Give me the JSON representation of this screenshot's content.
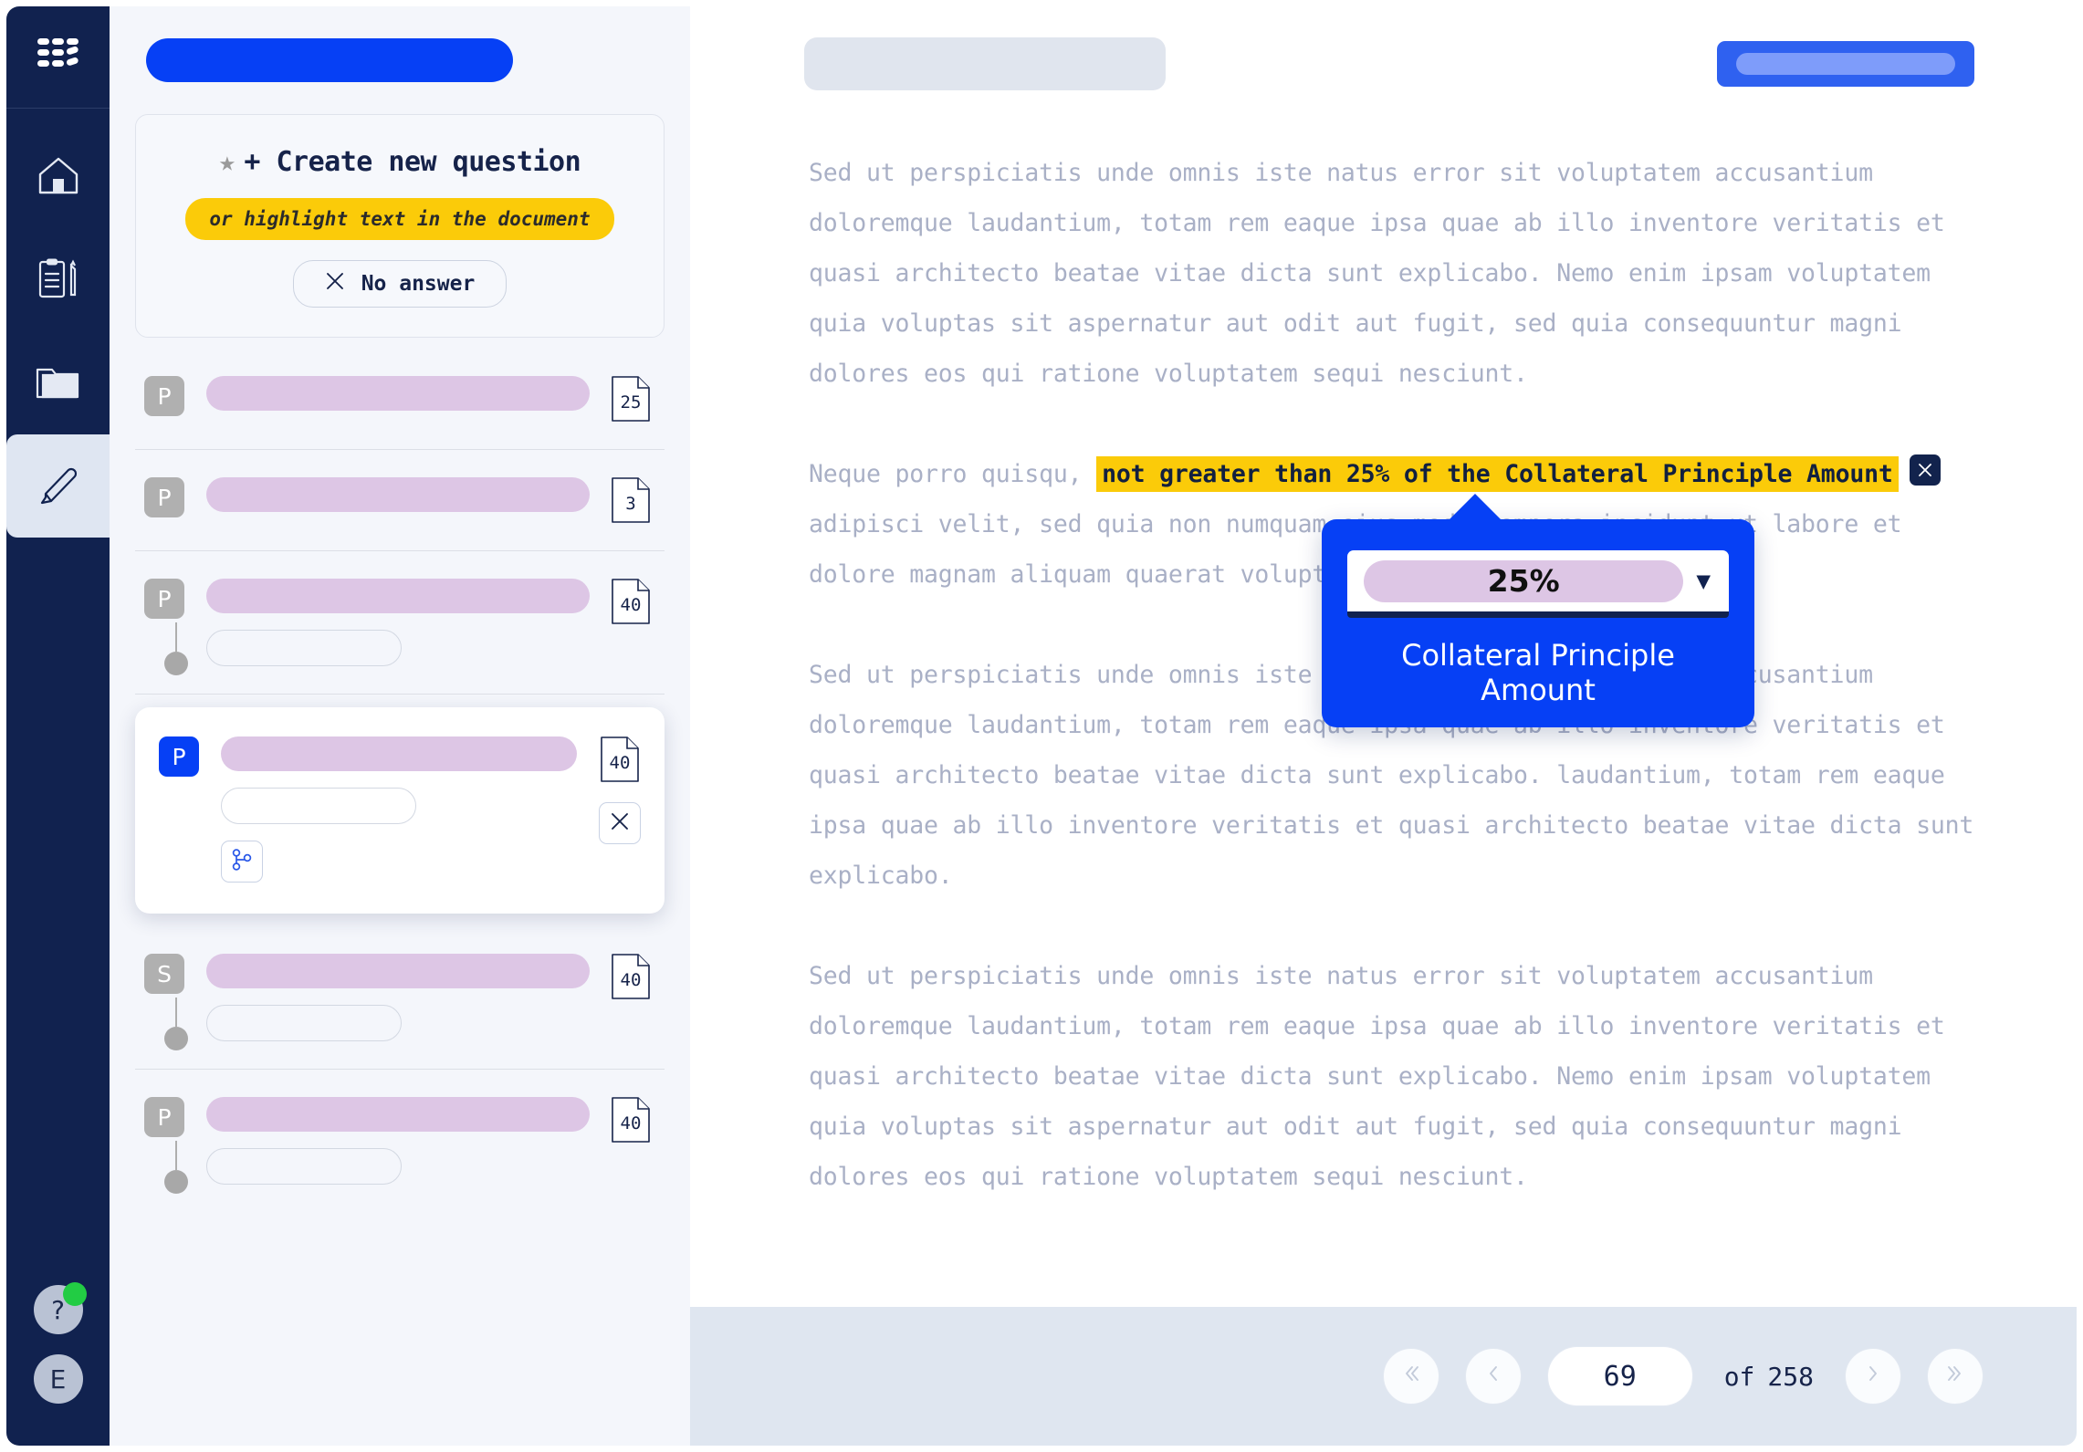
{
  "rail": {
    "logo": "apps-grid-logo",
    "items": [
      {
        "name": "home",
        "icon": "home-icon",
        "active": false
      },
      {
        "name": "tasks",
        "icon": "clipboard-pencil-icon",
        "active": false
      },
      {
        "name": "documents",
        "icon": "folder-icon",
        "active": false
      },
      {
        "name": "highlights",
        "icon": "highlighter-icon",
        "active": true
      }
    ],
    "help_label": "?",
    "avatar_label": "E"
  },
  "sidebar": {
    "create_card": {
      "star_icon": "star-icon",
      "title": "+ Create new question",
      "hint": "or highlight text in the document",
      "no_answer_icon": "close-icon",
      "no_answer_label": "No answer"
    },
    "questions": [
      {
        "badge": "P",
        "page": "25",
        "selected": false,
        "has_subfield": false
      },
      {
        "badge": "P",
        "page": "3",
        "selected": false,
        "has_subfield": false
      },
      {
        "badge": "P",
        "page": "40",
        "selected": false,
        "has_subfield": true
      },
      {
        "badge": "P",
        "page": "40",
        "selected": true,
        "has_subfield": true,
        "branch_icon": "branch-icon",
        "close_icon": "close-icon"
      },
      {
        "badge": "S",
        "page": "40",
        "selected": false,
        "has_subfield": true
      },
      {
        "badge": "P",
        "page": "40",
        "selected": false,
        "has_subfield": true
      }
    ]
  },
  "document": {
    "paragraphs": [
      "Sed ut perspiciatis unde omnis iste natus error sit voluptatem accusantium doloremque laudantium, totam rem eaque ipsa quae ab illo inventore veritatis et quasi architecto beatae vitae dicta sunt explicabo. Nemo enim ipsam voluptatem quia voluptas sit aspernatur aut odit aut fugit, sed quia consequuntur magni dolores eos qui ratione voluptatem sequi nesciunt.",
      "Sed ut perspiciatis unde omnis iste natus error sit voluptatem accusantium doloremque laudantium, totam rem eaque ipsa quae ab illo inventore veritatis et quasi architecto beatae vitae dicta sunt explicabo. laudantium, totam rem eaque ipsa quae ab illo inventore veritatis et quasi architecto beatae vitae dicta sunt explicabo.",
      "Sed ut perspiciatis unde omnis iste natus error sit voluptatem accusantium doloremque laudantium, totam rem eaque ipsa quae ab illo inventore veritatis et quasi architecto beatae vitae dicta sunt explicabo. Nemo enim ipsam voluptatem quia voluptas sit aspernatur aut odit aut fugit, sed quia consequuntur magni dolores eos qui ratione voluptatem sequi nesciunt."
    ],
    "highlight_paragraph": {
      "before": "Neque porro quisqu, ",
      "highlight": "not greater than 25% of the Collateral Principle Amount",
      "after": " adipisci velit, sed quia non numquam eius modi tempora incidunt ut labore et dolore magnam aliquam quaerat voluptatem."
    },
    "close_highlight_icon": "close-icon"
  },
  "tooltip": {
    "value": "25%",
    "caret_icon": "chevron-down-icon",
    "label": "Collateral Principle Amount"
  },
  "pagination": {
    "first_icon": "chevrons-left-icon",
    "prev_icon": "chevron-left-icon",
    "current_page": "69",
    "of_label": "of",
    "total_pages": "258",
    "next_icon": "chevron-right-icon",
    "last_icon": "chevrons-right-icon"
  },
  "colors": {
    "brand_blue": "#0640f5",
    "navy": "#11224f",
    "highlight_yellow": "#fbcb09",
    "placeholder_purple": "#ddc6e5",
    "online_green": "#22cc44"
  }
}
